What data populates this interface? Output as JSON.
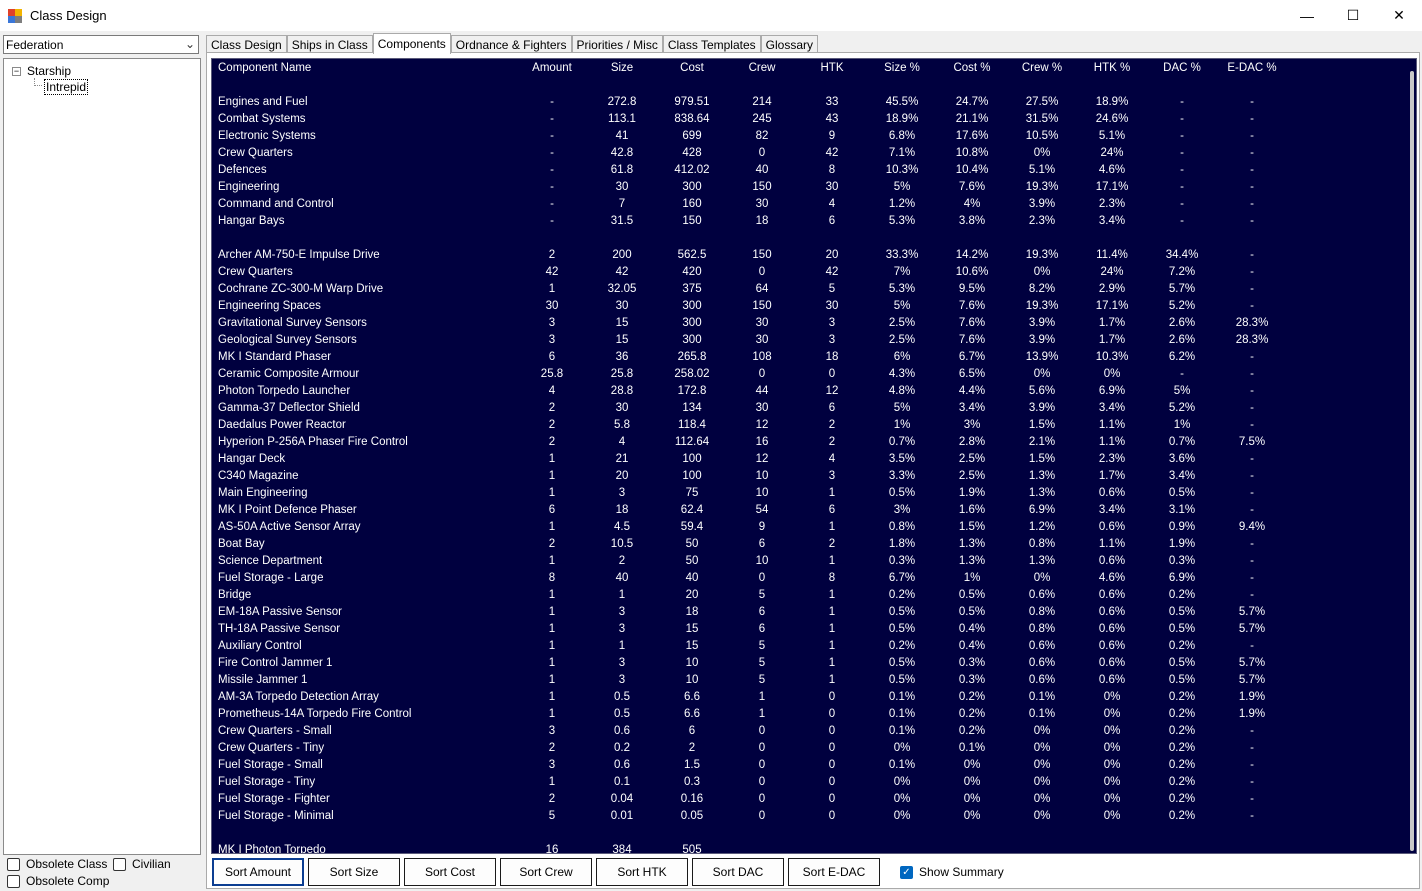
{
  "window": {
    "title": "Class Design",
    "minimize": "—",
    "maximize": "☐",
    "close": "✕"
  },
  "race_select": {
    "value": "Federation"
  },
  "tree": {
    "root": "Starship",
    "child": "Intrepid",
    "expander": "−"
  },
  "left_checks": {
    "obsolete_class": "Obsolete Class",
    "civilian": "Civilian",
    "obsolete_comp": "Obsolete Comp"
  },
  "tabs": [
    "Class Design",
    "Ships in Class",
    "Components",
    "Ordnance & Fighters",
    "Priorities / Misc",
    "Class Templates",
    "Glossary"
  ],
  "active_tab": "Components",
  "table": {
    "columns": [
      "Component Name",
      "Amount",
      "Size",
      "Cost",
      "Crew",
      "HTK",
      "Size %",
      "Cost %",
      "Crew %",
      "HTK %",
      "DAC %",
      "E-DAC %"
    ],
    "summary": [
      [
        "Engines and Fuel",
        "-",
        "272.8",
        "979.51",
        "214",
        "33",
        "45.5%",
        "24.7%",
        "27.5%",
        "18.9%",
        "-",
        "-"
      ],
      [
        "Combat Systems",
        "-",
        "113.1",
        "838.64",
        "245",
        "43",
        "18.9%",
        "21.1%",
        "31.5%",
        "24.6%",
        "-",
        "-"
      ],
      [
        "Electronic Systems",
        "-",
        "41",
        "699",
        "82",
        "9",
        "6.8%",
        "17.6%",
        "10.5%",
        "5.1%",
        "-",
        "-"
      ],
      [
        "Crew Quarters",
        "-",
        "42.8",
        "428",
        "0",
        "42",
        "7.1%",
        "10.8%",
        "0%",
        "24%",
        "-",
        "-"
      ],
      [
        "Defences",
        "-",
        "61.8",
        "412.02",
        "40",
        "8",
        "10.3%",
        "10.4%",
        "5.1%",
        "4.6%",
        "-",
        "-"
      ],
      [
        "Engineering",
        "-",
        "30",
        "300",
        "150",
        "30",
        "5%",
        "7.6%",
        "19.3%",
        "17.1%",
        "-",
        "-"
      ],
      [
        "Command and Control",
        "-",
        "7",
        "160",
        "30",
        "4",
        "1.2%",
        "4%",
        "3.9%",
        "2.3%",
        "-",
        "-"
      ],
      [
        "Hangar Bays",
        "-",
        "31.5",
        "150",
        "18",
        "6",
        "5.3%",
        "3.8%",
        "2.3%",
        "3.4%",
        "-",
        "-"
      ]
    ],
    "components": [
      [
        "Archer AM-750-E Impulse Drive",
        "2",
        "200",
        "562.5",
        "150",
        "20",
        "33.3%",
        "14.2%",
        "19.3%",
        "11.4%",
        "34.4%",
        "-"
      ],
      [
        "Crew Quarters",
        "42",
        "42",
        "420",
        "0",
        "42",
        "7%",
        "10.6%",
        "0%",
        "24%",
        "7.2%",
        "-"
      ],
      [
        "Cochrane ZC-300-M Warp Drive",
        "1",
        "32.05",
        "375",
        "64",
        "5",
        "5.3%",
        "9.5%",
        "8.2%",
        "2.9%",
        "5.7%",
        "-"
      ],
      [
        "Engineering Spaces",
        "30",
        "30",
        "300",
        "150",
        "30",
        "5%",
        "7.6%",
        "19.3%",
        "17.1%",
        "5.2%",
        "-"
      ],
      [
        "Gravitational Survey Sensors",
        "3",
        "15",
        "300",
        "30",
        "3",
        "2.5%",
        "7.6%",
        "3.9%",
        "1.7%",
        "2.6%",
        "28.3%"
      ],
      [
        "Geological Survey Sensors",
        "3",
        "15",
        "300",
        "30",
        "3",
        "2.5%",
        "7.6%",
        "3.9%",
        "1.7%",
        "2.6%",
        "28.3%"
      ],
      [
        "MK I Standard Phaser",
        "6",
        "36",
        "265.8",
        "108",
        "18",
        "6%",
        "6.7%",
        "13.9%",
        "10.3%",
        "6.2%",
        "-"
      ],
      [
        "Ceramic Composite Armour",
        "25.8",
        "25.8",
        "258.02",
        "0",
        "0",
        "4.3%",
        "6.5%",
        "0%",
        "0%",
        "-",
        "-"
      ],
      [
        "Photon Torpedo Launcher",
        "4",
        "28.8",
        "172.8",
        "44",
        "12",
        "4.8%",
        "4.4%",
        "5.6%",
        "6.9%",
        "5%",
        "-"
      ],
      [
        "Gamma-37 Deflector Shield",
        "2",
        "30",
        "134",
        "30",
        "6",
        "5%",
        "3.4%",
        "3.9%",
        "3.4%",
        "5.2%",
        "-"
      ],
      [
        "Daedalus Power Reactor",
        "2",
        "5.8",
        "118.4",
        "12",
        "2",
        "1%",
        "3%",
        "1.5%",
        "1.1%",
        "1%",
        "-"
      ],
      [
        "Hyperion P-256A Phaser Fire Control",
        "2",
        "4",
        "112.64",
        "16",
        "2",
        "0.7%",
        "2.8%",
        "2.1%",
        "1.1%",
        "0.7%",
        "7.5%"
      ],
      [
        "Hangar Deck",
        "1",
        "21",
        "100",
        "12",
        "4",
        "3.5%",
        "2.5%",
        "1.5%",
        "2.3%",
        "3.6%",
        "-"
      ],
      [
        "C340 Magazine",
        "1",
        "20",
        "100",
        "10",
        "3",
        "3.3%",
        "2.5%",
        "1.3%",
        "1.7%",
        "3.4%",
        "-"
      ],
      [
        "Main Engineering",
        "1",
        "3",
        "75",
        "10",
        "1",
        "0.5%",
        "1.9%",
        "1.3%",
        "0.6%",
        "0.5%",
        "-"
      ],
      [
        "MK I Point Defence Phaser",
        "6",
        "18",
        "62.4",
        "54",
        "6",
        "3%",
        "1.6%",
        "6.9%",
        "3.4%",
        "3.1%",
        "-"
      ],
      [
        "AS-50A Active Sensor Array",
        "1",
        "4.5",
        "59.4",
        "9",
        "1",
        "0.8%",
        "1.5%",
        "1.2%",
        "0.6%",
        "0.9%",
        "9.4%"
      ],
      [
        "Boat Bay",
        "2",
        "10.5",
        "50",
        "6",
        "2",
        "1.8%",
        "1.3%",
        "0.8%",
        "1.1%",
        "1.9%",
        "-"
      ],
      [
        "Science Department",
        "1",
        "2",
        "50",
        "10",
        "1",
        "0.3%",
        "1.3%",
        "1.3%",
        "0.6%",
        "0.3%",
        "-"
      ],
      [
        "Fuel Storage - Large",
        "8",
        "40",
        "40",
        "0",
        "8",
        "6.7%",
        "1%",
        "0%",
        "4.6%",
        "6.9%",
        "-"
      ],
      [
        "Bridge",
        "1",
        "1",
        "20",
        "5",
        "1",
        "0.2%",
        "0.5%",
        "0.6%",
        "0.6%",
        "0.2%",
        "-"
      ],
      [
        "EM-18A Passive Sensor",
        "1",
        "3",
        "18",
        "6",
        "1",
        "0.5%",
        "0.5%",
        "0.8%",
        "0.6%",
        "0.5%",
        "5.7%"
      ],
      [
        "TH-18A Passive Sensor",
        "1",
        "3",
        "15",
        "6",
        "1",
        "0.5%",
        "0.4%",
        "0.8%",
        "0.6%",
        "0.5%",
        "5.7%"
      ],
      [
        "Auxiliary Control",
        "1",
        "1",
        "15",
        "5",
        "1",
        "0.2%",
        "0.4%",
        "0.6%",
        "0.6%",
        "0.2%",
        "-"
      ],
      [
        "Fire Control Jammer 1",
        "1",
        "3",
        "10",
        "5",
        "1",
        "0.5%",
        "0.3%",
        "0.6%",
        "0.6%",
        "0.5%",
        "5.7%"
      ],
      [
        "Missile Jammer 1",
        "1",
        "3",
        "10",
        "5",
        "1",
        "0.5%",
        "0.3%",
        "0.6%",
        "0.6%",
        "0.5%",
        "5.7%"
      ],
      [
        "AM-3A Torpedo Detection Array",
        "1",
        "0.5",
        "6.6",
        "1",
        "0",
        "0.1%",
        "0.2%",
        "0.1%",
        "0%",
        "0.2%",
        "1.9%"
      ],
      [
        "Prometheus-14A Torpedo Fire Control",
        "1",
        "0.5",
        "6.6",
        "1",
        "0",
        "0.1%",
        "0.2%",
        "0.1%",
        "0%",
        "0.2%",
        "1.9%"
      ],
      [
        "Crew Quarters - Small",
        "3",
        "0.6",
        "6",
        "0",
        "0",
        "0.1%",
        "0.2%",
        "0%",
        "0%",
        "0.2%",
        "-"
      ],
      [
        "Crew Quarters - Tiny",
        "2",
        "0.2",
        "2",
        "0",
        "0",
        "0%",
        "0.1%",
        "0%",
        "0%",
        "0.2%",
        "-"
      ],
      [
        "Fuel Storage - Small",
        "3",
        "0.6",
        "1.5",
        "0",
        "0",
        "0.1%",
        "0%",
        "0%",
        "0%",
        "0.2%",
        "-"
      ],
      [
        "Fuel Storage - Tiny",
        "1",
        "0.1",
        "0.3",
        "0",
        "0",
        "0%",
        "0%",
        "0%",
        "0%",
        "0.2%",
        "-"
      ],
      [
        "Fuel Storage - Fighter",
        "2",
        "0.04",
        "0.16",
        "0",
        "0",
        "0%",
        "0%",
        "0%",
        "0%",
        "0.2%",
        "-"
      ],
      [
        "Fuel Storage - Minimal",
        "5",
        "0.01",
        "0.05",
        "0",
        "0",
        "0%",
        "0%",
        "0%",
        "0%",
        "0.2%",
        "-"
      ]
    ],
    "ordnance": [
      [
        "MK I Photon Torpedo",
        "16",
        "384",
        "505",
        "",
        "",
        "",
        "",
        "",
        "",
        "",
        ""
      ]
    ]
  },
  "buttons": [
    "Sort Amount",
    "Sort Size",
    "Sort Cost",
    "Sort Crew",
    "Sort HTK",
    "Sort DAC",
    "Sort E-DAC"
  ],
  "show_summary": {
    "label": "Show Summary",
    "checked": true,
    "check": "✓"
  }
}
